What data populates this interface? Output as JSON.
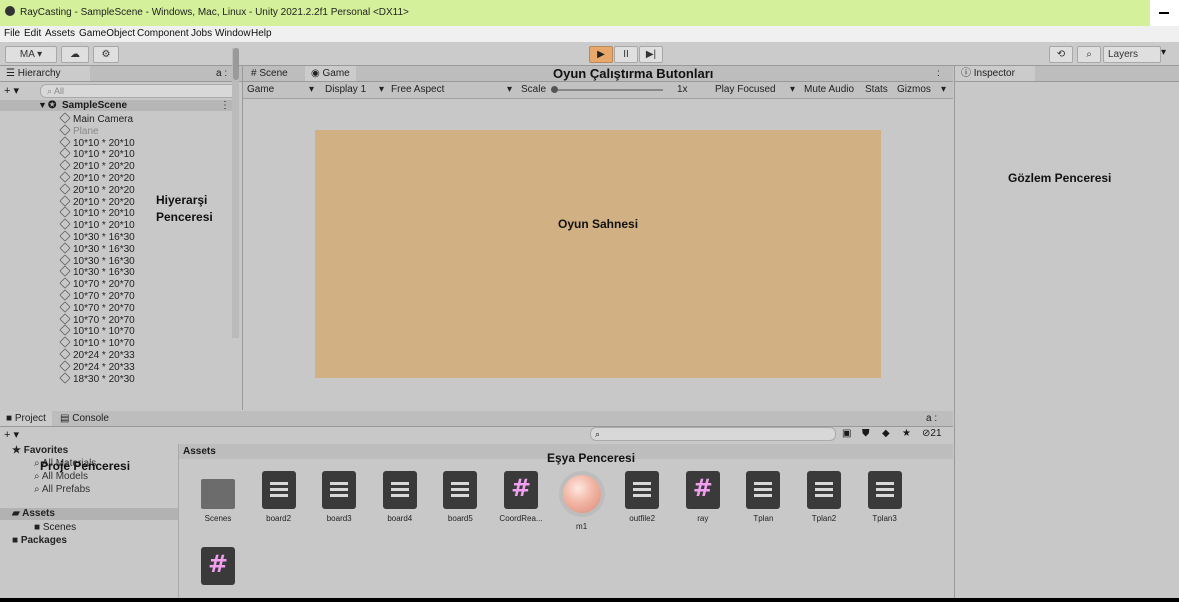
{
  "window": {
    "title": "RayCasting - SampleScene - Windows, Mac, Linux - Unity 2021.2.2f1 Personal <DX11>",
    "minimize_glyph": "–"
  },
  "menu": [
    "File",
    "Edit",
    "Assets",
    "GameObject",
    "Component",
    "Jobs",
    "Window",
    "Help"
  ],
  "toolbar": {
    "account_label": "MA ▾",
    "cloud_icon": "cloud-icon",
    "play_icon": "▶",
    "pause_icon": "II",
    "step_icon": "▶|",
    "history_icon": "⟲",
    "search_icon": "⌕",
    "layers_label": "Layers",
    "layers_arrow": "▾"
  },
  "hierarchy": {
    "tab_label": "Hierarchy",
    "lock": "a :",
    "add_label": "+ ▾",
    "search_placeholder": "All",
    "scene_name": "SampleScene",
    "items": [
      "Main Camera",
      "Plane",
      "10*10 * 20*10",
      "10*10 * 20*10",
      "20*10 * 20*20",
      "20*10 * 20*20",
      "20*10 * 20*20",
      "20*10 * 20*20",
      "10*10 * 20*10",
      "10*10 * 20*10",
      "10*30 * 16*30",
      "10*30 * 16*30",
      "10*30 * 16*30",
      "10*30 * 16*30",
      "10*70 * 20*70",
      "10*70 * 20*70",
      "10*70 * 20*70",
      "10*70 * 20*70",
      "10*10 * 10*70",
      "10*10 * 10*70",
      "20*24 * 20*33",
      "20*24 * 20*33",
      "18*30 * 20*30"
    ]
  },
  "game": {
    "tabs": [
      "# Scene",
      "Game"
    ],
    "menu_dots": ":",
    "toolbar": {
      "display_mode": "Game",
      "display": "Display 1",
      "aspect": "Free Aspect",
      "scale_label": "Scale",
      "scale_value": "1x",
      "play_focused": "Play Focused",
      "mute": "Mute Audio",
      "stats": "Stats",
      "gizmos": "Gizmos"
    }
  },
  "inspector": {
    "tab_label": "Inspector"
  },
  "project": {
    "tabs": [
      "Project",
      "Console"
    ],
    "add_label": "+ ▾",
    "lock": "a :",
    "hidden_count": "21",
    "favorites": {
      "label": "Favorites",
      "items": [
        "All Materials",
        "All Models",
        "All Prefabs"
      ]
    },
    "assets_tree": {
      "label": "Assets",
      "children": [
        "Scenes"
      ],
      "packages": "Packages"
    },
    "breadcrumb": "Assets",
    "assets": [
      {
        "name": "Scenes",
        "type": "folder"
      },
      {
        "name": "board2",
        "type": "text"
      },
      {
        "name": "board3",
        "type": "text"
      },
      {
        "name": "board4",
        "type": "text"
      },
      {
        "name": "board5",
        "type": "text"
      },
      {
        "name": "CoordRea...",
        "type": "script"
      },
      {
        "name": "m1",
        "type": "material"
      },
      {
        "name": "outfile2",
        "type": "text"
      },
      {
        "name": "ray",
        "type": "script"
      },
      {
        "name": "Tplan",
        "type": "text"
      },
      {
        "name": "Tplan2",
        "type": "text"
      },
      {
        "name": "Tplan3",
        "type": "text"
      },
      {
        "name": "",
        "type": "script"
      }
    ]
  },
  "annotations": {
    "buttons": "Oyun Çalıştırma Butonları",
    "hierarchy_1": "Hiyerarşi",
    "hierarchy_2": "Penceresi",
    "scene": "Oyun Sahnesi",
    "inspector": "Gözlem Penceresi",
    "project": "Proje Penceresi",
    "assets": "Eşya Penceresi"
  },
  "colors": {
    "titlebar": "#d4f09a",
    "game_screen": "#d1b183",
    "play_active": "#e8a86b"
  }
}
